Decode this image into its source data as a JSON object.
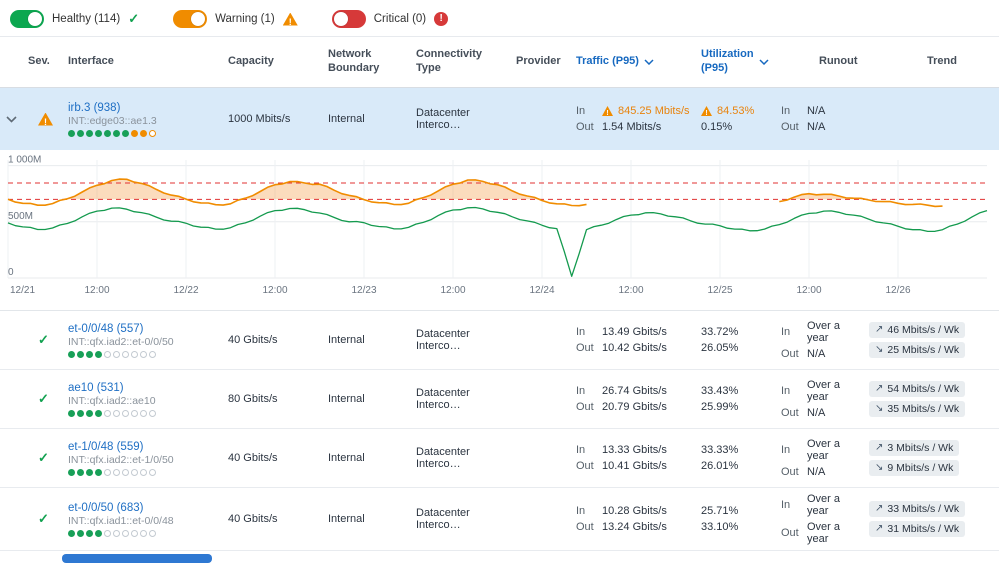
{
  "icons": {
    "check": "✓"
  },
  "filters": [
    {
      "label": "Healthy (114)",
      "icon": "check",
      "color": "#0ca750",
      "knob": "right",
      "state": "on"
    },
    {
      "label": "Warning (1)",
      "icon": "warning",
      "color": "#f08c00",
      "knob": "right",
      "state": "on"
    },
    {
      "label": "Critical (0)",
      "icon": "critical",
      "color": "#d63939",
      "knob": "left",
      "state": "on"
    }
  ],
  "header": {
    "sev": "Sev.",
    "interface": "Interface",
    "capacity": "Capacity",
    "boundary_l1": "Network",
    "boundary_l2": "Boundary",
    "conn_l1": "Connectivity",
    "conn_l2": "Type",
    "provider": "Provider",
    "traffic": "Traffic (P95)",
    "util_l1": "Utilization",
    "util_l2": "(P95)",
    "runout": "Runout",
    "trend": "Trend"
  },
  "rows": [
    {
      "severity": "warning",
      "expanded": true,
      "name": "irb.3 (938)",
      "sub": "INT::edge03::ae1.3",
      "dots": [
        "g",
        "g",
        "g",
        "g",
        "g",
        "g",
        "g",
        "o",
        "o",
        "O"
      ],
      "capacity": "1000 Mbits/s",
      "boundary": "Internal",
      "conn": "Datacenter Interco…",
      "provider": "",
      "traffic": {
        "in_label": "In",
        "in_warn": true,
        "in": "845.25 Mbits/s",
        "out_label": "Out",
        "out": "1.54 Mbits/s"
      },
      "util": {
        "in_warn": true,
        "in": "84.53%",
        "out": "0.15%"
      },
      "runout": {
        "in_label": "In",
        "in": "N/A",
        "out_label": "Out",
        "out": "N/A"
      },
      "trend": []
    },
    {
      "severity": "healthy",
      "expanded": false,
      "name": "et-0/0/48 (557)",
      "sub": "INT::qfx.iad2::et-0/0/50",
      "dots": [
        "g",
        "g",
        "g",
        "g",
        "e",
        "e",
        "e",
        "e",
        "e",
        "e"
      ],
      "capacity": "40 Gbits/s",
      "boundary": "Internal",
      "conn": "Datacenter Interco…",
      "provider": "",
      "traffic": {
        "in_label": "In",
        "in_warn": false,
        "in": "13.49 Gbits/s",
        "out_label": "Out",
        "out": "10.42 Gbits/s"
      },
      "util": {
        "in_warn": false,
        "in": "33.72%",
        "out": "26.05%"
      },
      "runout": {
        "in_label": "In",
        "in": "Over a year",
        "out_label": "Out",
        "out": "N/A"
      },
      "trend": [
        {
          "arrow": "↗",
          "text": "46 Mbits/s / Wk"
        },
        {
          "arrow": "↘",
          "text": "25 Mbits/s / Wk"
        }
      ]
    },
    {
      "severity": "healthy",
      "expanded": false,
      "name": "ae10 (531)",
      "sub": "INT::qfx.iad2::ae10",
      "dots": [
        "g",
        "g",
        "g",
        "g",
        "e",
        "e",
        "e",
        "e",
        "e",
        "e"
      ],
      "capacity": "80 Gbits/s",
      "boundary": "Internal",
      "conn": "Datacenter Interco…",
      "provider": "",
      "traffic": {
        "in_label": "In",
        "in_warn": false,
        "in": "26.74 Gbits/s",
        "out_label": "Out",
        "out": "20.79 Gbits/s"
      },
      "util": {
        "in_warn": false,
        "in": "33.43%",
        "out": "25.99%"
      },
      "runout": {
        "in_label": "In",
        "in": "Over a year",
        "out_label": "Out",
        "out": "N/A"
      },
      "trend": [
        {
          "arrow": "↗",
          "text": "54 Mbits/s / Wk"
        },
        {
          "arrow": "↘",
          "text": "35 Mbits/s / Wk"
        }
      ]
    },
    {
      "severity": "healthy",
      "expanded": false,
      "name": "et-1/0/48 (559)",
      "sub": "INT::qfx.iad2::et-1/0/50",
      "dots": [
        "g",
        "g",
        "g",
        "g",
        "e",
        "e",
        "e",
        "e",
        "e",
        "e"
      ],
      "capacity": "40 Gbits/s",
      "boundary": "Internal",
      "conn": "Datacenter Interco…",
      "provider": "",
      "traffic": {
        "in_label": "In",
        "in_warn": false,
        "in": "13.33 Gbits/s",
        "out_label": "Out",
        "out": "10.41 Gbits/s"
      },
      "util": {
        "in_warn": false,
        "in": "33.33%",
        "out": "26.01%"
      },
      "runout": {
        "in_label": "In",
        "in": "Over a year",
        "out_label": "Out",
        "out": "N/A"
      },
      "trend": [
        {
          "arrow": "↗",
          "text": "3 Mbits/s / Wk"
        },
        {
          "arrow": "↘",
          "text": "9 Mbits/s / Wk"
        }
      ]
    },
    {
      "severity": "healthy",
      "expanded": false,
      "name": "et-0/0/50 (683)",
      "sub": "INT::qfx.iad1::et-0/0/48",
      "dots": [
        "g",
        "g",
        "g",
        "g",
        "e",
        "e",
        "e",
        "e",
        "e",
        "e"
      ],
      "capacity": "40 Gbits/s",
      "boundary": "Internal",
      "conn": "Datacenter Interco…",
      "provider": "",
      "traffic": {
        "in_label": "In",
        "in_warn": false,
        "in": "10.28 Gbits/s",
        "out_label": "Out",
        "out": "13.24 Gbits/s"
      },
      "util": {
        "in_warn": false,
        "in": "25.71%",
        "out": "33.10%"
      },
      "runout": {
        "in_label": "In",
        "in": "Over a year",
        "out_label": "Out",
        "out": "Over a year"
      },
      "trend": [
        {
          "arrow": "↗",
          "text": "33 Mbits/s / Wk"
        },
        {
          "arrow": "↗",
          "text": "31 Mbits/s / Wk"
        }
      ]
    }
  ],
  "chart_data": {
    "type": "line",
    "unit": "Mbits/s",
    "x_hours_step": 2,
    "x_max_hours": 132,
    "ylim": [
      0,
      1050
    ],
    "ygrid": [
      0,
      500,
      1000
    ],
    "ylabels": [
      "0",
      "500M",
      "1 000M"
    ],
    "ticks": [
      {
        "t": 0,
        "label": "12/21"
      },
      {
        "t": 12,
        "label": "12:00"
      },
      {
        "t": 24,
        "label": "12/22"
      },
      {
        "t": 36,
        "label": "12:00"
      },
      {
        "t": 48,
        "label": "12/23"
      },
      {
        "t": 60,
        "label": "12:00"
      },
      {
        "t": 72,
        "label": "12/24"
      },
      {
        "t": 84,
        "label": "12:00"
      },
      {
        "t": 96,
        "label": "12/25"
      },
      {
        "t": 108,
        "label": "12:00"
      },
      {
        "t": 120,
        "label": "12/26"
      }
    ],
    "thresholds": [
      845.25,
      700
    ],
    "threshold_color": "#e03131",
    "band_fill": "rgba(243,146,50,0.32)",
    "series": [
      {
        "name": "In traffic",
        "color": "#f08c00",
        "values": [
          700,
          665,
          648,
          662,
          705,
          765,
          825,
          868,
          878,
          842,
          788,
          738,
          702,
          668,
          652,
          660,
          710,
          770,
          830,
          858,
          845,
          835,
          780,
          735,
          698,
          670,
          655,
          665,
          715,
          775,
          835,
          872,
          860,
          830,
          775,
          730,
          690,
          660,
          645,
          655,
          null,
          null,
          null,
          null,
          null,
          null,
          null,
          null,
          null,
          null,
          null,
          null,
          680,
          720,
          750,
          745,
          730,
          710,
          695,
          680,
          665,
          655,
          648,
          640,
          null,
          null,
          null
        ]
      },
      {
        "name": "Out traffic",
        "color": "#149a4e",
        "values": [
          490,
          455,
          432,
          445,
          485,
          545,
          595,
          622,
          612,
          582,
          542,
          505,
          488,
          452,
          435,
          448,
          490,
          550,
          600,
          618,
          608,
          578,
          538,
          500,
          492,
          458,
          438,
          450,
          495,
          555,
          605,
          625,
          615,
          585,
          545,
          508,
          470,
          440,
          15,
          430,
          470,
          520,
          560,
          580,
          570,
          545,
          510,
          480,
          465,
          435,
          420,
          435,
          475,
          530,
          575,
          595,
          585,
          560,
          525,
          490,
          460,
          430,
          415,
          430,
          480,
          545,
          600
        ]
      }
    ]
  }
}
